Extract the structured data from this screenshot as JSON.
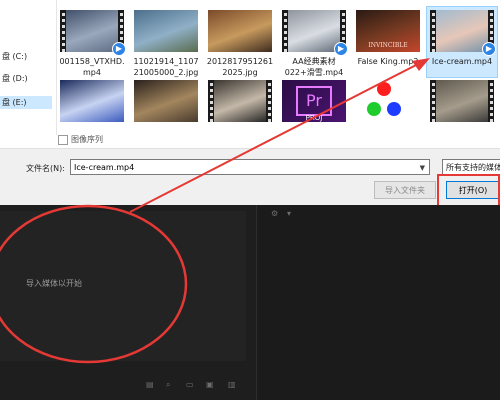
{
  "nav": {
    "drives": [
      "盘 (C:)",
      "盘 (D:)",
      "盘 (E:)"
    ],
    "selected_index": 2
  },
  "files": [
    {
      "name": "001158_VTXHD.\nmp4",
      "kind": "video",
      "badge": true,
      "colors": [
        "#3b4b64",
        "#9aa8bd",
        "#58677e"
      ]
    },
    {
      "name": "11021914_1107\n21005000_2.jpg",
      "kind": "image",
      "colors": [
        "#4e6f8c",
        "#8fb0c6",
        "#5a6b4e"
      ]
    },
    {
      "name": "2012817951261\n2025.jpg",
      "kind": "image",
      "colors": [
        "#7b4a2a",
        "#c79a5e",
        "#3d2b1f"
      ]
    },
    {
      "name": "AA经典素材\n022+滑雪.mp4",
      "kind": "video",
      "badge": true,
      "colors": [
        "#8a8f99",
        "#d9dde3",
        "#55606d"
      ]
    },
    {
      "name": "False King.mp3",
      "kind": "audio",
      "colors": [
        "#2a1a14",
        "#7a3b22",
        "#c6452c"
      ]
    },
    {
      "name": "Ice-cream.mp4",
      "kind": "video",
      "badge": true,
      "selected": true,
      "colors": [
        "#9dbad0",
        "#e6c7b8",
        "#6d8ea8"
      ]
    },
    {
      "name": "",
      "kind": "image",
      "colors": [
        "#1a2a5a",
        "#c7d3f2",
        "#3b5bbd"
      ]
    },
    {
      "name": "",
      "kind": "image",
      "colors": [
        "#2a211c",
        "#a3865e",
        "#4a3b2f"
      ]
    },
    {
      "name": "",
      "kind": "video",
      "colors": [
        "#302c28",
        "#c4b8a8",
        "#1a1a1a"
      ]
    },
    {
      "name": "",
      "kind": "app",
      "colors": [
        "#2b0d45",
        "#e77bff",
        "#4a1470"
      ]
    },
    {
      "name": "",
      "kind": "dots",
      "colors": [
        "#ff1e1e",
        "#1ecc2e",
        "#1e3cff"
      ]
    },
    {
      "name": "",
      "kind": "video",
      "colors": [
        "#5a544a",
        "#a59c8c",
        "#333"
      ]
    }
  ],
  "image_sequence_label": "图像序列",
  "filename_label": "文件名(N):",
  "filename_value": "Ice-cream.mp4",
  "filter_value": "所有支持的媒体",
  "import_folder_label": "导入文件夹",
  "open_label": "打开(O)",
  "app_logo_text": "Pr",
  "app_logo_subtext": "PROJ",
  "audio_thumb_text": "INVINCIBLE",
  "premiere": {
    "import_hint": "导入媒体以开始"
  },
  "annotation_color": "#e53935"
}
